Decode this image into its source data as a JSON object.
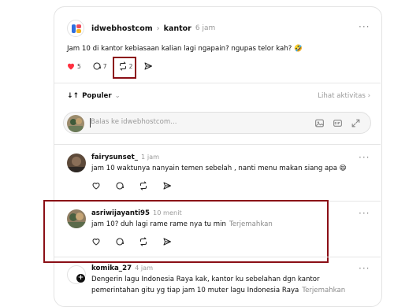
{
  "colors": {
    "like_red": "#ff3040",
    "highlight": "#8b0f16",
    "muted": "#9a9a9a"
  },
  "post": {
    "author": "idwebhostcom",
    "breadcrumb_sep": "›",
    "topic": "kantor",
    "time": "6 jam",
    "text": "Jam 10 di kantor kebiasaan kalian lagi ngapain? ngupas telor kah? 🤣",
    "likes": "5",
    "replies": "7",
    "reposts": "2",
    "icons": {
      "like": "heart-filled-icon",
      "reply": "comment-icon",
      "repost": "repost-icon",
      "share": "send-icon"
    }
  },
  "sort_bar": {
    "label": "Populer",
    "activity_label": "Lihat aktivitas"
  },
  "reply_box": {
    "placeholder": "Balas ke idwebhostcom..."
  },
  "comments": [
    {
      "author": "fairysunset_",
      "time": "1 jam",
      "text": "jam 10 waktunya nanyain temen sebelah , nanti menu makan siang apa 😄"
    },
    {
      "author": "asriwijayanti95",
      "time": "10 menit",
      "text": "jam 10? duh lagi rame rame nya tu min",
      "translate": "Terjemahkan"
    },
    {
      "author": "komika_27",
      "time": "4 jam",
      "text_line1": "Dengerin lagu Indonesia Raya kak, kantor ku sebelahan dgn kantor",
      "text_line2": "pemerintahan gitu yg tiap jam 10 muter lagu Indonesia Raya",
      "translate": "Terjemahkan"
    }
  ]
}
